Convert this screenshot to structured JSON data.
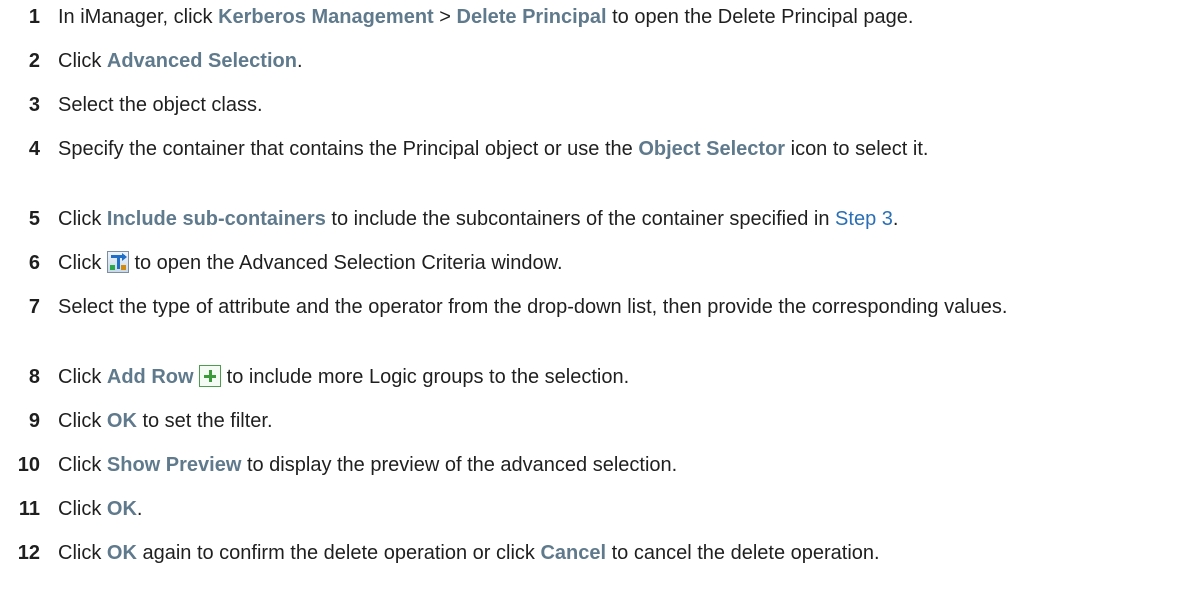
{
  "steps": [
    {
      "num": "1",
      "parts": [
        "In iManager, click ",
        "Kerberos Management",
        " > ",
        "Delete Principal",
        " to open the Delete Principal page."
      ]
    },
    {
      "num": "2",
      "parts": [
        "Click ",
        "Advanced Selection",
        "."
      ]
    },
    {
      "num": "3",
      "parts": [
        "Select the object class."
      ]
    },
    {
      "num": "4",
      "parts": [
        "Specify the container that contains the Principal object or use the ",
        "Object Selector",
        " icon to select it."
      ]
    },
    {
      "num": "5",
      "parts": [
        "Click ",
        "Include sub-containers",
        " to include the subcontainers of the container specified in ",
        "Step 3",
        "."
      ]
    },
    {
      "num": "6",
      "parts": [
        "Click ",
        " to open the Advanced Selection Criteria window."
      ],
      "icon": "advanced-selection-criteria-icon"
    },
    {
      "num": "7",
      "parts": [
        "Select the type of attribute and the operator from the drop-down list, then provide the corresponding values."
      ]
    },
    {
      "num": "8",
      "parts": [
        "Click ",
        "Add Row",
        " ",
        " to include more Logic groups to the selection."
      ],
      "icon": "add-row-icon"
    },
    {
      "num": "9",
      "parts": [
        "Click ",
        "OK",
        " to set the filter."
      ]
    },
    {
      "num": "10",
      "parts": [
        "Click ",
        "Show Preview",
        " to display the preview of the advanced selection."
      ]
    },
    {
      "num": "11",
      "parts": [
        "Click ",
        "OK",
        "."
      ]
    },
    {
      "num": "12",
      "parts": [
        "Click ",
        "OK",
        " again to confirm the delete operation or click ",
        "Cancel",
        " to cancel the delete operation."
      ]
    }
  ],
  "colors": {
    "ui_term": "#5f7a8c",
    "link": "#2a6fb6",
    "text": "#1f1f1f"
  }
}
